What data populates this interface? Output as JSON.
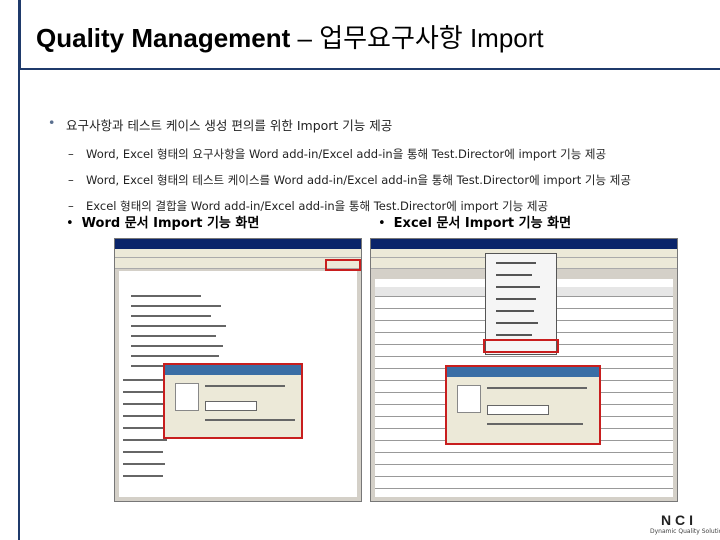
{
  "header": {
    "title_bold": "Quality Management",
    "title_dash": " – ",
    "title_rest": "업무요구사항 Import"
  },
  "bullets": {
    "main": "요구사항과 테스트 케이스 생성 편의를 위한 Import 기능 제공",
    "sub": [
      "Word, Excel 형태의 요구사항을 Word add-in/Excel add-in을 통해 Test.Director에 import 기능 제공",
      "Word, Excel 형태의 테스트 케이스를 Word add-in/Excel add-in을 통해 Test.Director에 import 기능 제공",
      "Excel 형태의 결합을 Word add-in/Excel add-in을 통해 Test.Director에 import 기능 제공"
    ],
    "dash": "–"
  },
  "screens": {
    "word_label": "Word 문서 Import 기능 화면",
    "excel_label": "Excel 문서 Import 기능 화면",
    "bullet": "•"
  },
  "logo": {
    "mark": "NCI",
    "tagline": "Dynamic Quality Solutions"
  },
  "colors": {
    "accent": "#1f3a6b",
    "highlight": "#c81e1e"
  }
}
